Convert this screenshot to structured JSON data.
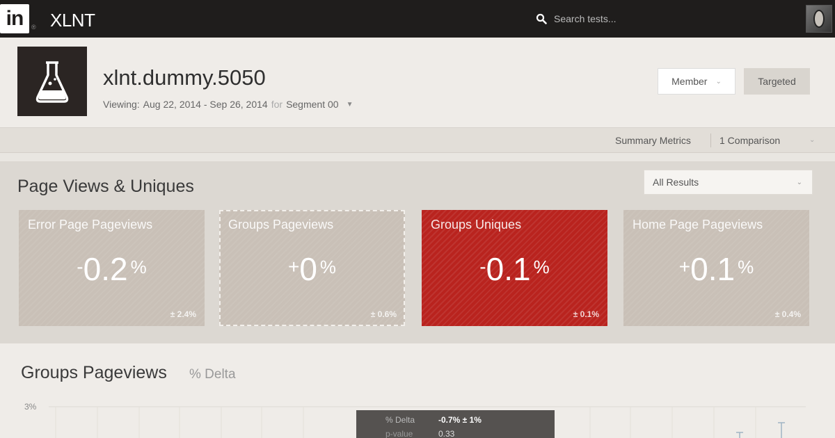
{
  "nav": {
    "logo_text": "in",
    "app_name": "XLNT",
    "search_placeholder": "Search tests..."
  },
  "header": {
    "test_name": "xlnt.dummy.5050",
    "viewing_prefix": "Viewing:",
    "date_range": "Aug 22, 2014 - Sep 26, 2014",
    "for_label": "for",
    "segment": "Segment 00",
    "member_label": "Member",
    "targeted_label": "Targeted"
  },
  "summary_bar": {
    "summary_label": "Summary Metrics",
    "comparison_label": "1 Comparison"
  },
  "metrics": {
    "title": "Page Views & Uniques",
    "filter_value": "All Results",
    "cards": [
      {
        "name": "Error Page Pageviews",
        "sign": "-",
        "value": "0.2",
        "unit": "%",
        "ci": "± 2.4%",
        "status": "neutral"
      },
      {
        "name": "Groups Pageviews",
        "sign": "+",
        "value": "0",
        "unit": "%",
        "ci": "± 0.6%",
        "status": "neutral-selected"
      },
      {
        "name": "Groups Uniques",
        "sign": "-",
        "value": "0.1",
        "unit": "%",
        "ci": "± 0.1%",
        "status": "negative"
      },
      {
        "name": "Home Page Pageviews",
        "sign": "+",
        "value": "0.1",
        "unit": "%",
        "ci": "± 0.4%",
        "status": "neutral"
      }
    ]
  },
  "chart": {
    "title": "Groups Pageviews",
    "subtitle": "% Delta",
    "y_tick_top": "3%",
    "tooltip": {
      "label": "% Delta",
      "value": "-0.7% ± 1%",
      "label2": "p-value",
      "value2": "0.33"
    }
  },
  "colors": {
    "nav_bg": "#1f1d1c",
    "neutral_card": "#c9c0b7",
    "negative_card": "#b9231e",
    "page_bg": "#e9e6e1"
  }
}
